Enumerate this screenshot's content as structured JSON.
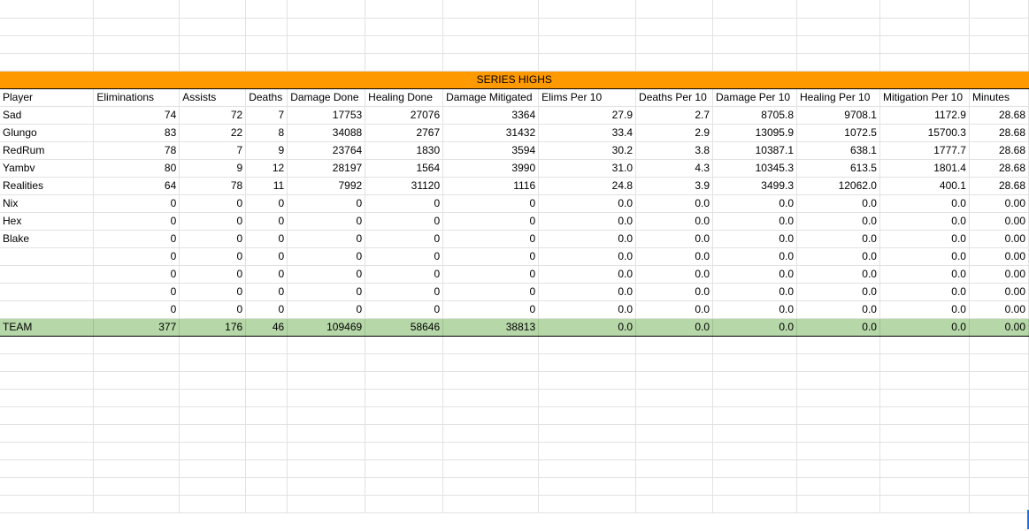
{
  "banner": "SERIES HIGHS",
  "headers": [
    "Player",
    "Eliminations",
    "Assists",
    "Deaths",
    "Damage Done",
    "Healing Done",
    "Damage Mitigated",
    "Elims Per 10",
    "Deaths Per 10",
    "Damage Per 10",
    "Healing Per 10",
    "Mitigation Per 10",
    "Minutes"
  ],
  "rows": [
    [
      "Sad",
      "74",
      "72",
      "7",
      "17753",
      "27076",
      "3364",
      "27.9",
      "2.7",
      "8705.8",
      "9708.1",
      "1172.9",
      "28.68"
    ],
    [
      "Glungo",
      "83",
      "22",
      "8",
      "34088",
      "2767",
      "31432",
      "33.4",
      "2.9",
      "13095.9",
      "1072.5",
      "15700.3",
      "28.68"
    ],
    [
      "RedRum",
      "78",
      "7",
      "9",
      "23764",
      "1830",
      "3594",
      "30.2",
      "3.8",
      "10387.1",
      "638.1",
      "1777.7",
      "28.68"
    ],
    [
      "Yambv",
      "80",
      "9",
      "12",
      "28197",
      "1564",
      "3990",
      "31.0",
      "4.3",
      "10345.3",
      "613.5",
      "1801.4",
      "28.68"
    ],
    [
      "Realities",
      "64",
      "78",
      "11",
      "7992",
      "31120",
      "1116",
      "24.8",
      "3.9",
      "3499.3",
      "12062.0",
      "400.1",
      "28.68"
    ],
    [
      "Nix",
      "0",
      "0",
      "0",
      "0",
      "0",
      "0",
      "0.0",
      "0.0",
      "0.0",
      "0.0",
      "0.0",
      "0.00"
    ],
    [
      "Hex",
      "0",
      "0",
      "0",
      "0",
      "0",
      "0",
      "0.0",
      "0.0",
      "0.0",
      "0.0",
      "0.0",
      "0.00"
    ],
    [
      "Blake",
      "0",
      "0",
      "0",
      "0",
      "0",
      "0",
      "0.0",
      "0.0",
      "0.0",
      "0.0",
      "0.0",
      "0.00"
    ],
    [
      "",
      "0",
      "0",
      "0",
      "0",
      "0",
      "0",
      "0.0",
      "0.0",
      "0.0",
      "0.0",
      "0.0",
      "0.00"
    ],
    [
      "",
      "0",
      "0",
      "0",
      "0",
      "0",
      "0",
      "0.0",
      "0.0",
      "0.0",
      "0.0",
      "0.0",
      "0.00"
    ],
    [
      "",
      "0",
      "0",
      "0",
      "0",
      "0",
      "0",
      "0.0",
      "0.0",
      "0.0",
      "0.0",
      "0.0",
      "0.00"
    ],
    [
      "",
      "0",
      "0",
      "0",
      "0",
      "0",
      "0",
      "0.0",
      "0.0",
      "0.0",
      "0.0",
      "0.0",
      "0.00"
    ]
  ],
  "team": [
    "TEAM",
    "377",
    "176",
    "46",
    "109469",
    "58646",
    "38813",
    "0.0",
    "0.0",
    "0.0",
    "0.0",
    "0.0",
    "0.00"
  ],
  "colors": {
    "banner": "#ff9900",
    "team_row": "#b6d7a8",
    "gridline": "#e2e2e2"
  }
}
